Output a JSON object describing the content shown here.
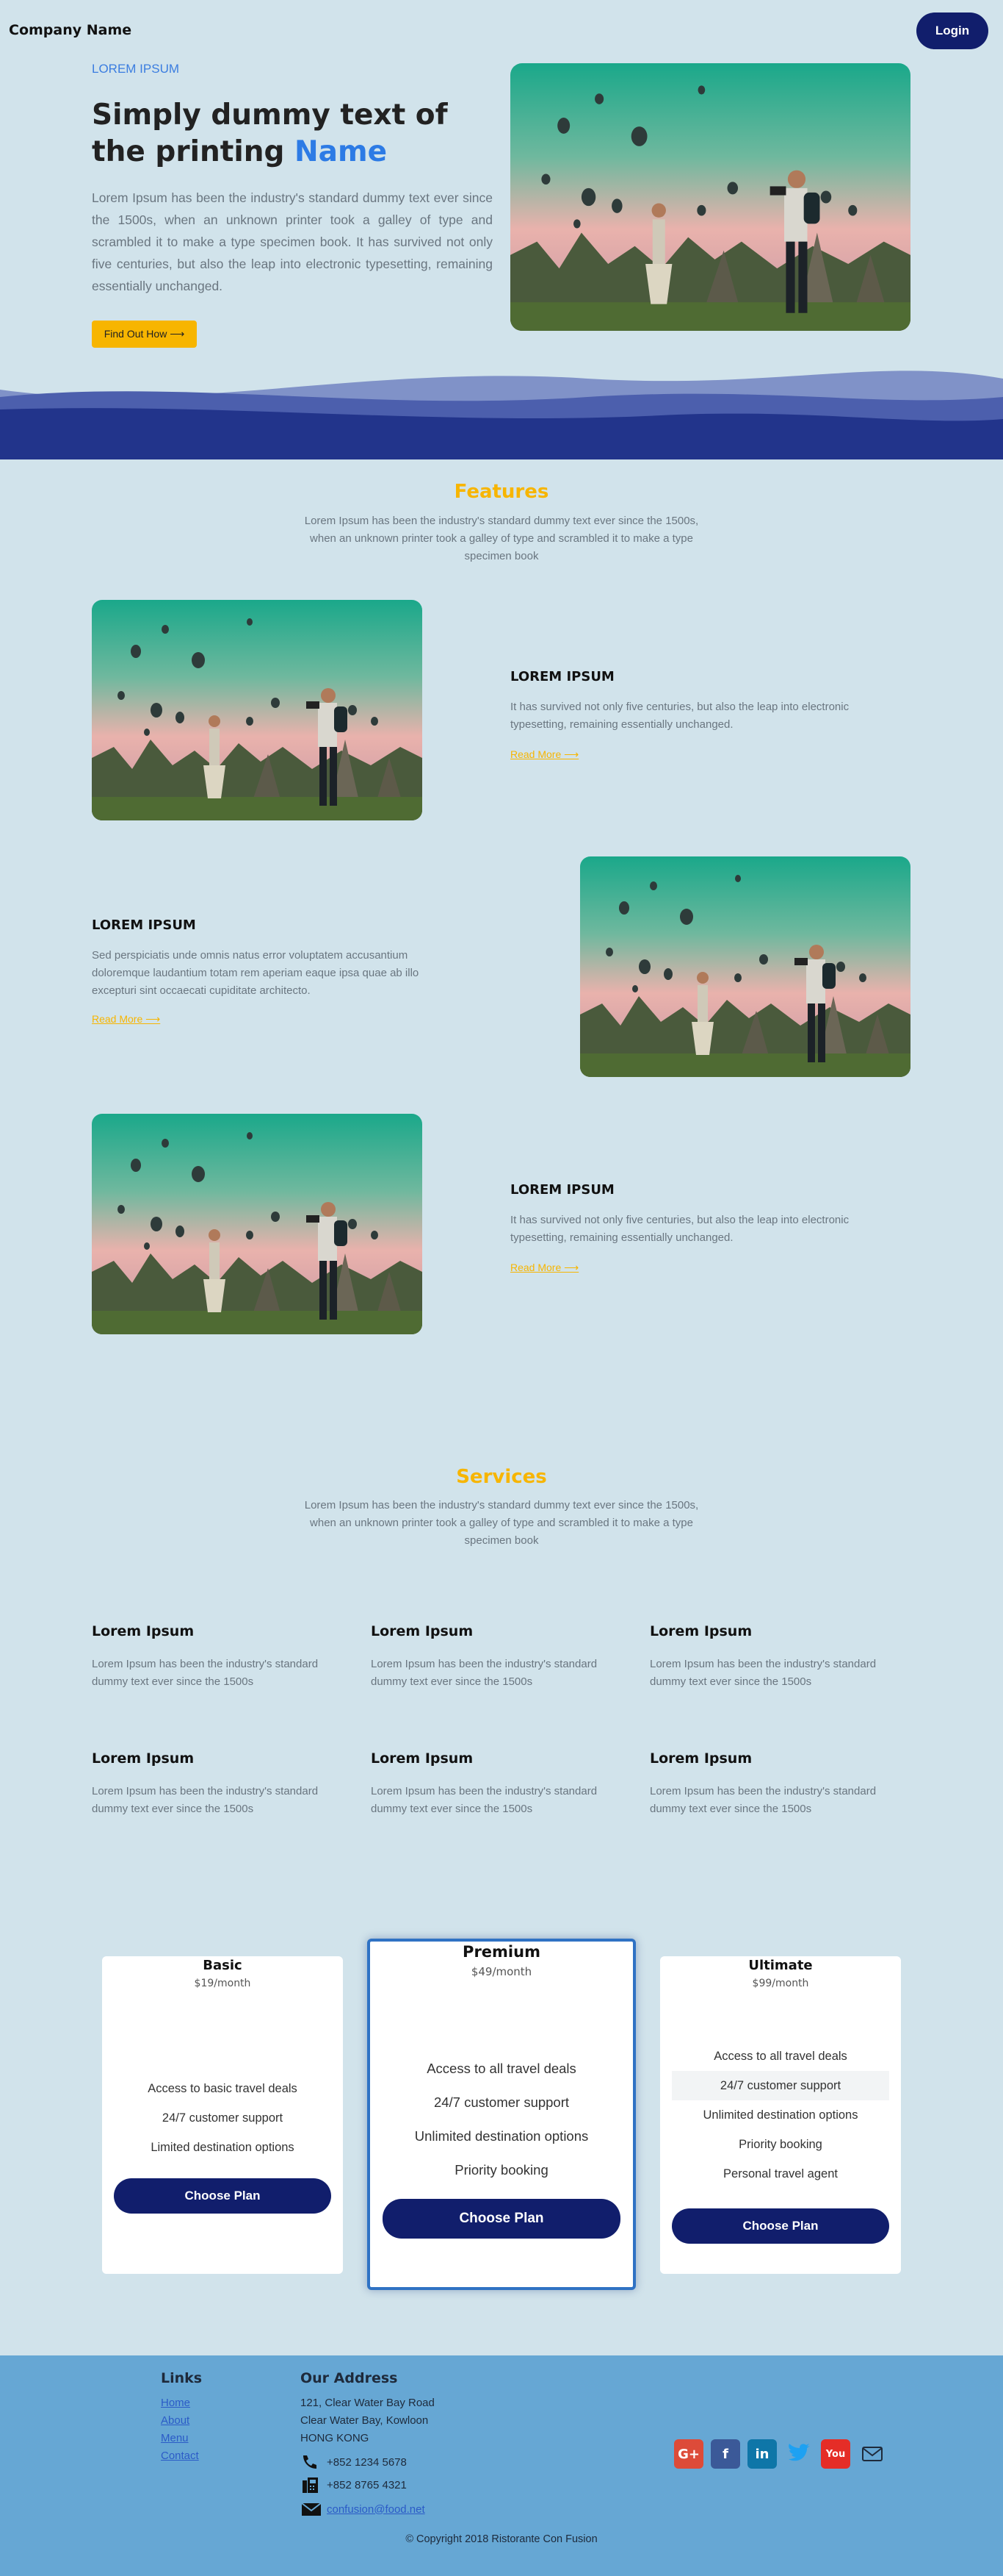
{
  "header": {
    "brand": "Company Name",
    "login_label": "Login"
  },
  "hero": {
    "kicker": "LOREM IPSUM",
    "title_prefix": "Simply dummy text of the printing",
    "title_accent": "Name",
    "description": "Lorem Ipsum has been the industry's standard dummy text ever since the 1500s, when an unknown printer took a galley of type and scrambled it to make a type specimen book. It has survived not only five centuries, but also the leap into electronic typesetting, remaining essentially unchanged.",
    "cta_label": "Find Out How ⟶"
  },
  "features": {
    "title": "Features",
    "description": "Lorem Ipsum has been the industry's standard dummy text ever since the 1500s, when an unknown printer took a galley of type and scrambled it to make a type specimen book",
    "items": [
      {
        "title": "LOREM IPSUM",
        "text": "It has survived not only five centuries, but also the leap into electronic typesetting, remaining essentially unchanged.",
        "link": "Read More ⟶"
      },
      {
        "title": "LOREM IPSUM",
        "text": "Sed perspiciatis unde omnis natus error voluptatem accusantium doloremque laudantium totam rem aperiam eaque ipsa quae ab illo excepturi sint occaecati cupiditate architecto.",
        "link": "Read More ⟶"
      },
      {
        "title": "LOREM IPSUM",
        "text": "It has survived not only five centuries, but also the leap into electronic typesetting, remaining essentially unchanged.",
        "link": "Read More ⟶"
      }
    ]
  },
  "services": {
    "title": "Services",
    "description": "Lorem Ipsum has been the industry's standard dummy text ever since the 1500s, when an unknown printer took a galley of type and scrambled it to make a type specimen book",
    "items": [
      {
        "title": "Lorem Ipsum",
        "text": "Lorem Ipsum has been the industry's standard dummy text ever since the 1500s"
      },
      {
        "title": "Lorem Ipsum",
        "text": "Lorem Ipsum has been the industry's standard dummy text ever since the 1500s"
      },
      {
        "title": "Lorem Ipsum",
        "text": "Lorem Ipsum has been the industry's standard dummy text ever since the 1500s"
      },
      {
        "title": "Lorem Ipsum",
        "text": "Lorem Ipsum has been the industry's standard dummy text ever since the 1500s"
      },
      {
        "title": "Lorem Ipsum",
        "text": "Lorem Ipsum has been the industry's standard dummy text ever since the 1500s"
      },
      {
        "title": "Lorem Ipsum",
        "text": "Lorem Ipsum has been the industry's standard dummy text ever since the 1500s"
      }
    ]
  },
  "pricing": {
    "plans": [
      {
        "name": "Basic",
        "price": "$19/month",
        "features": [
          "Access to basic travel deals",
          "24/7 customer support",
          "Limited destination options"
        ],
        "cta": "Choose Plan"
      },
      {
        "name": "Premium",
        "price": "$49/month",
        "features": [
          "Access to all travel deals",
          "24/7 customer support",
          "Unlimited destination options",
          "Priority booking"
        ],
        "cta": "Choose Plan"
      },
      {
        "name": "Ultimate",
        "price": "$99/month",
        "features": [
          "Access to all travel deals",
          "24/7 customer support",
          "Unlimited destination options",
          "Priority booking",
          "Personal travel agent"
        ],
        "cta": "Choose Plan"
      }
    ]
  },
  "footer": {
    "links_title": "Links",
    "links": [
      "Home",
      "About",
      "Menu",
      "Contact"
    ],
    "address_title": "Our Address",
    "address_lines": [
      "121, Clear Water Bay Road",
      "Clear Water Bay, Kowloon",
      "HONG KONG"
    ],
    "phone": "+852 1234 5678",
    "fax": "+852 8765 4321",
    "email": "confusion@food.net",
    "socials": [
      "google-plus-icon",
      "facebook-icon",
      "linkedin-icon",
      "twitter-icon",
      "youtube-icon",
      "mail-icon"
    ],
    "copyright": "© Copyright 2018 Ristorante Con Fusion"
  },
  "colors": {
    "background": "#d1e3eb",
    "navy": "#111e6c",
    "accent_yellow": "#f7b500",
    "accent_blue": "#2d7be5",
    "footer": "#66a7d4"
  }
}
